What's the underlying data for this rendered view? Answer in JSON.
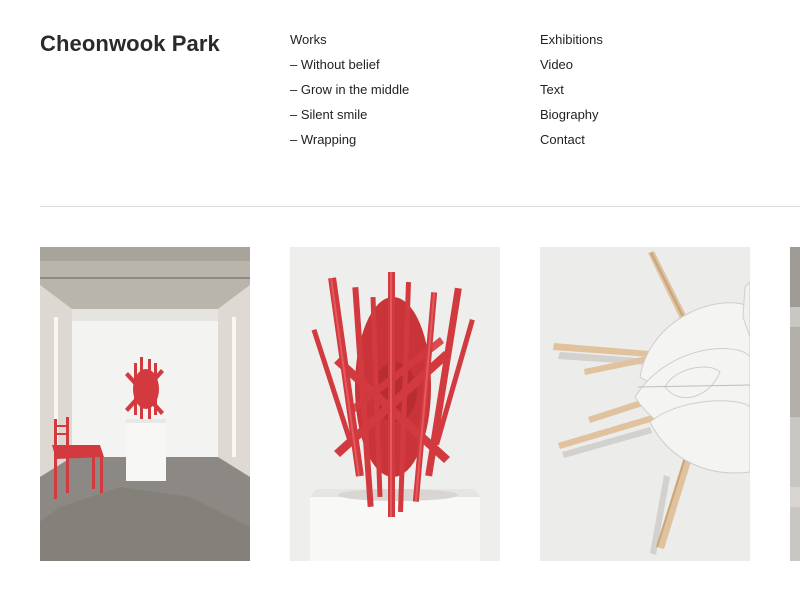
{
  "site": {
    "title": "Cheonwook Park"
  },
  "nav": {
    "works": [
      {
        "label": "Works"
      },
      {
        "label": "– Without belief"
      },
      {
        "label": "– Grow in the middle"
      },
      {
        "label": "– Silent smile"
      },
      {
        "label": "– Wrapping"
      }
    ],
    "main": [
      {
        "label": "Exhibitions"
      },
      {
        "label": "Video"
      },
      {
        "label": "Text"
      },
      {
        "label": "Biography"
      },
      {
        "label": "Contact"
      }
    ]
  },
  "gallery": {
    "items": [
      {
        "subject": "red sculpture and red chair in gallery room"
      },
      {
        "subject": "red spiky sculpture on white pedestal"
      },
      {
        "subject": "white and wood wall sculpture"
      },
      {
        "subject": "partially visible artwork"
      }
    ]
  },
  "colors": {
    "accent_red": "#d23a3f",
    "text": "#222222",
    "divider": "#dcdcdc"
  }
}
